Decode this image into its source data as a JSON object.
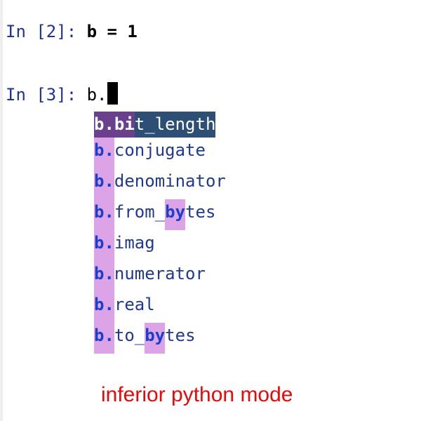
{
  "session": {
    "cell2": {
      "prompt": "In [2]: ",
      "code": "b = 1"
    },
    "cell3": {
      "prompt": "In [3]: ",
      "code": "b."
    }
  },
  "completions": [
    {
      "segments": [
        {
          "text": "b.bi",
          "match": true
        },
        {
          "text": "t_length",
          "match": false
        }
      ],
      "selected": true
    },
    {
      "segments": [
        {
          "text": "b.",
          "match": true
        },
        {
          "text": "conjugate",
          "match": false
        }
      ],
      "selected": false
    },
    {
      "segments": [
        {
          "text": "b.",
          "match": true
        },
        {
          "text": "denominator",
          "match": false
        }
      ],
      "selected": false
    },
    {
      "segments": [
        {
          "text": "b.",
          "match": true
        },
        {
          "text": "from_",
          "match": false
        },
        {
          "text": "by",
          "match": true
        },
        {
          "text": "tes",
          "match": false
        }
      ],
      "selected": false
    },
    {
      "segments": [
        {
          "text": "b.",
          "match": true
        },
        {
          "text": "imag",
          "match": false
        }
      ],
      "selected": false
    },
    {
      "segments": [
        {
          "text": "b.",
          "match": true
        },
        {
          "text": "numerator",
          "match": false
        }
      ],
      "selected": false
    },
    {
      "segments": [
        {
          "text": "b.",
          "match": true
        },
        {
          "text": "real",
          "match": false
        }
      ],
      "selected": false
    },
    {
      "segments": [
        {
          "text": "b.",
          "match": true
        },
        {
          "text": "to_",
          "match": false
        },
        {
          "text": "by",
          "match": true
        },
        {
          "text": "tes",
          "match": false
        }
      ],
      "selected": false
    }
  ],
  "caption": "inferior python mode",
  "colors": {
    "prompt": "#20339a",
    "match_bg": "#dca4e6",
    "selected_match_bg": "#6a3f8e",
    "selected_rest_bg": "#2d4f75",
    "caption": "#ea0707"
  }
}
